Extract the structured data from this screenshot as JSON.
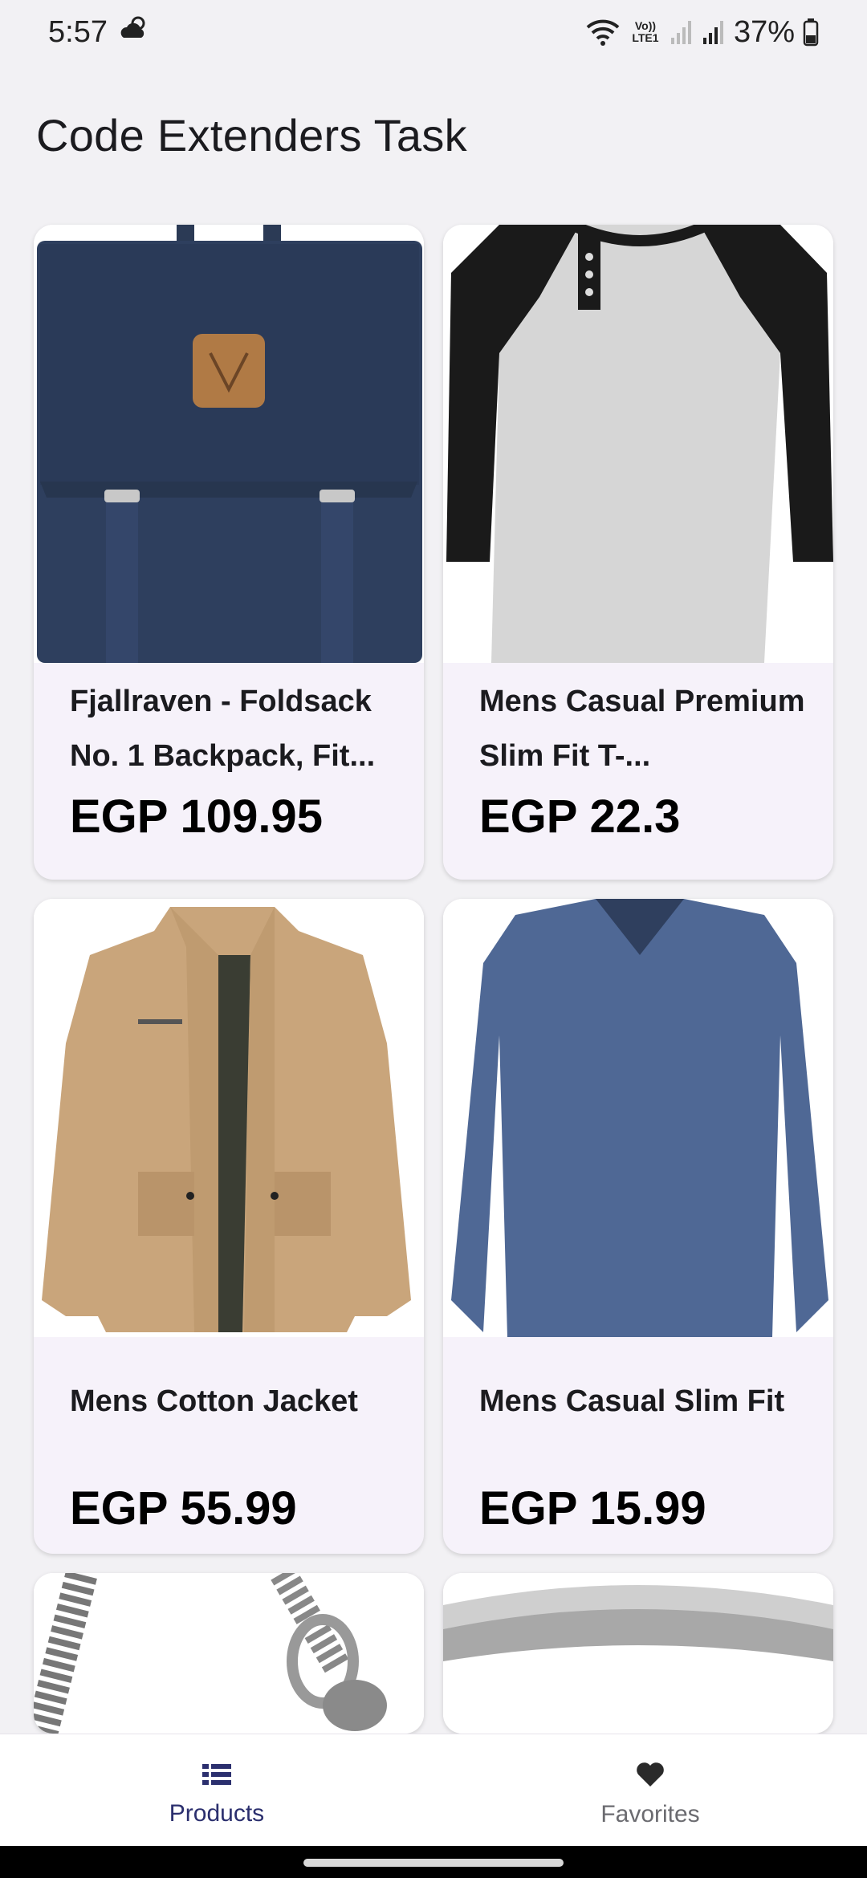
{
  "status_bar": {
    "time": "5:57",
    "battery": "37%",
    "icons": [
      "weather-icon",
      "wifi-icon",
      "volte-icon",
      "signal-icon",
      "signal-icon",
      "battery-icon"
    ],
    "volte_label": "Vo)) LTE1"
  },
  "app": {
    "title": "Code Extenders Task"
  },
  "products": [
    {
      "name": "Fjallraven - Foldsack No. 1 Backpack, Fit...",
      "price": "EGP 109.95",
      "image": "backpack-image"
    },
    {
      "name": "Mens Casual Premium Slim Fit T-...",
      "price": "EGP 22.3",
      "image": "raglan-tshirt-image"
    },
    {
      "name": "Mens Cotton Jacket",
      "price": "EGP 55.99",
      "image": "jacket-image"
    },
    {
      "name": "Mens Casual Slim Fit",
      "price": "EGP 15.99",
      "image": "blue-longsleeve-image"
    },
    {
      "name": "",
      "price": "",
      "image": "chain-bracelet-image"
    },
    {
      "name": "",
      "price": "",
      "image": "silver-ring-image"
    }
  ],
  "bottom_nav": {
    "items": [
      {
        "label": "Products",
        "icon": "list-icon",
        "active": true
      },
      {
        "label": "Favorites",
        "icon": "heart-icon",
        "active": false
      }
    ]
  },
  "colors": {
    "background": "#f2f1f4",
    "card": "#f6f2fa",
    "active_nav": "#2b2f6e",
    "inactive_nav": "#6b6b70"
  }
}
